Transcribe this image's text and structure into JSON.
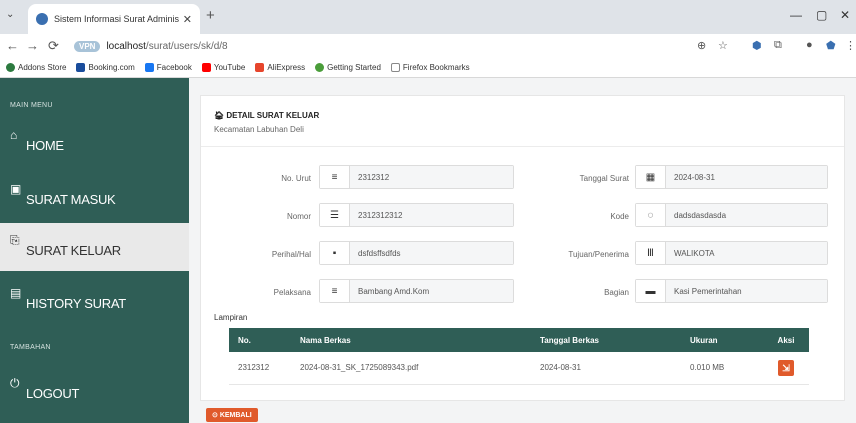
{
  "browser": {
    "tab_title": "Sistem Informasi Surat Adminis",
    "url_host": "localhost",
    "url_path": "/surat/users/sk/d/8",
    "vpn_badge": "VPN",
    "bookmarks": [
      {
        "label": "Addons Store",
        "color": "#2c7a3f"
      },
      {
        "label": "Booking.com",
        "color": "#1a4d9c"
      },
      {
        "label": "Facebook",
        "color": "#1877f2"
      },
      {
        "label": "YouTube",
        "color": "#ff0000"
      },
      {
        "label": "AliExpress",
        "color": "#e6452c"
      },
      {
        "label": "Getting Started",
        "color": "#4a9d3a"
      },
      {
        "label": "Firefox Bookmarks",
        "color": "#888888"
      }
    ]
  },
  "sidebar": {
    "main_menu_label": "MAIN MENU",
    "extra_label": "TAMBAHAN",
    "items": [
      {
        "label": "HOME",
        "icon": "home-icon"
      },
      {
        "label": "SURAT MASUK",
        "icon": "inbox-icon"
      },
      {
        "label": "SURAT KELUAR",
        "icon": "outbox-icon",
        "active": true
      },
      {
        "label": "HISTORY SURAT",
        "icon": "history-icon"
      },
      {
        "label": "LOGOUT",
        "icon": "power-icon"
      }
    ]
  },
  "detail": {
    "title": "DETAIL SURAT KELUAR",
    "subtitle": "Kecamatan Labuhan Deli",
    "fields": {
      "no_urut_label": "No. Urut",
      "no_urut": "2312312",
      "nomor_label": "Nomor",
      "nomor": "2312312312",
      "perihal_label": "Perihal/Hal",
      "perihal": "dsfdsffsdfds",
      "pelaksana_label": "Pelaksana",
      "pelaksana": "Bambang Amd.Kom",
      "tanggal_label": "Tanggal Surat",
      "tanggal": "2024-08-31",
      "kode_label": "Kode",
      "kode": "dadsdasdasda",
      "tujuan_label": "Tujuan/Penerima",
      "tujuan": "WALIKOTA",
      "bagian_label": "Bagian",
      "bagian": "Kasi Pemerintahan"
    },
    "lampiran_label": "Lampiran",
    "table": {
      "headers": [
        "No.",
        "Nama Berkas",
        "Tanggal Berkas",
        "Ukuran",
        "Aksi"
      ],
      "rows": [
        {
          "no": "2312312",
          "nama": "2024-08-31_SK_1725089343.pdf",
          "tanggal": "2024-08-31",
          "ukuran": "0.010 MB"
        }
      ]
    },
    "back_label": "KEMBALI"
  }
}
